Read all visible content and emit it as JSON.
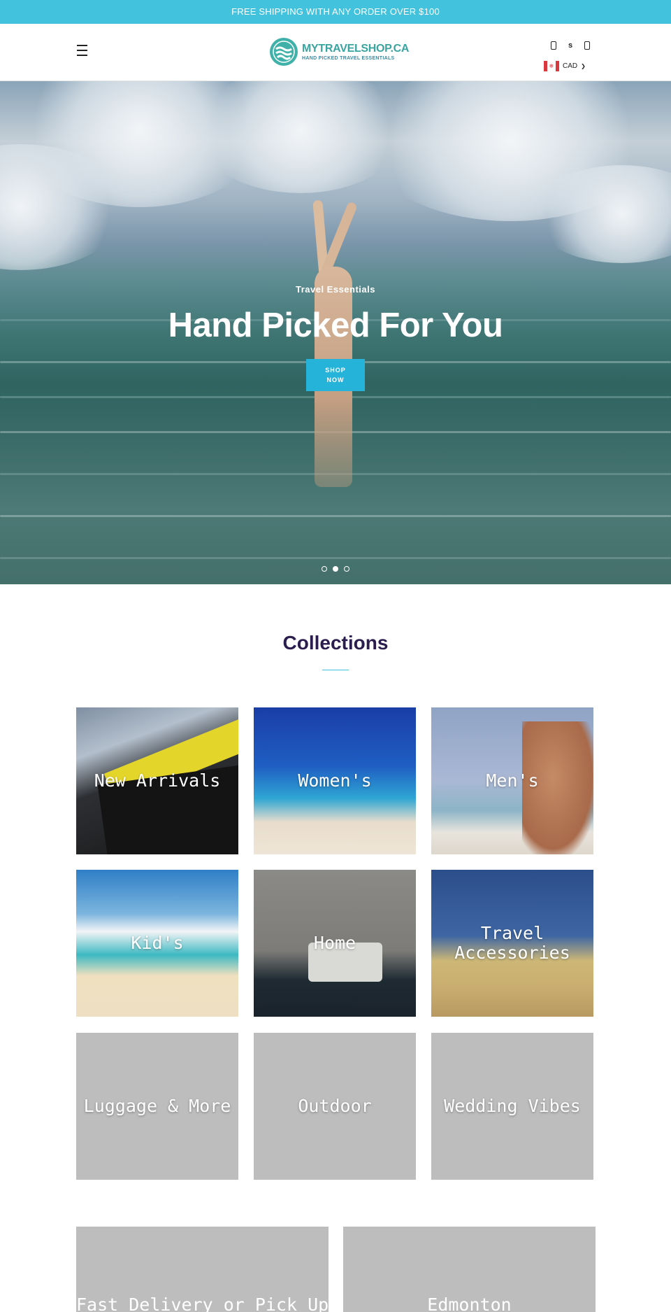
{
  "announcement": {
    "text": "FREE SHIPPING WITH ANY ORDER OVER $100"
  },
  "header": {
    "logo_name": "MYTRAVELSHOP.CA",
    "logo_tagline": "HAND PICKED TRAVEL ESSENTIALS",
    "icons": [
      "search-icon",
      "account-icon",
      "cart-icon"
    ],
    "account_glyph": "s",
    "currency": "CAD"
  },
  "hero": {
    "subtitle": "Travel Essentials",
    "title": "Hand Picked For You",
    "button_line1": "SHOP",
    "button_line2": "NOW",
    "slides": 3,
    "active_slide": 2
  },
  "collections": {
    "title": "Collections",
    "items": [
      {
        "label": "New Arrivals"
      },
      {
        "label": "Women's"
      },
      {
        "label": "Men's"
      },
      {
        "label": "Kid's"
      },
      {
        "label": "Home"
      },
      {
        "label": "Travel Accessories"
      },
      {
        "label": "Luggage & More"
      },
      {
        "label": "Outdoor"
      },
      {
        "label": "Wedding Vibes"
      }
    ]
  },
  "promos": [
    {
      "label": "Fast Delivery or Pick Up"
    },
    {
      "label": "Edmonton"
    }
  ],
  "colors": {
    "accent": "#43c2dd",
    "button": "#26b3d9",
    "heading": "#2b1d4e",
    "logo": "#3aa5a0",
    "placeholder": "#bdbdbd"
  }
}
